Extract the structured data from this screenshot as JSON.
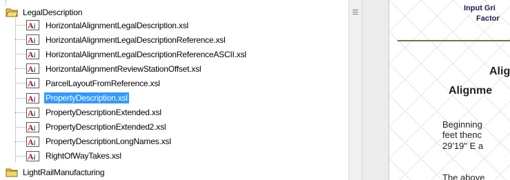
{
  "tree": {
    "parent_folder": "LegalDescription",
    "items": [
      "HorizontalAlignmentLegalDescription.xsl",
      "HorizontalAlignmentLegalDescriptionReference.xsl",
      "HorizontalAlignmentLegalDescriptionReferenceASCII.xsl",
      "HorizontalAlignmentReviewStationOffset.xsl",
      "ParcelLayoutFromReference.xsl",
      "PropertyDescription.xsl",
      "PropertyDescriptionExtended.xsl",
      "PropertyDescriptionExtended2.xsl",
      "PropertyDescriptionLongNames.xsl",
      "RightOfWayTakes.xsl"
    ],
    "selected_item": "PropertyDescription.xsl",
    "next_folder": "LightRailManufacturing"
  },
  "preview": {
    "header_line1": "Input Gri",
    "header_line2": "Factor",
    "title_line1": "Alig",
    "title_line2": "Alignme",
    "body_line1": "Beginning",
    "body_line2": "feet thenc",
    "body_line3": "29'19\" E a",
    "body_line4": "The above"
  },
  "colors": {
    "selection": "#3399ff",
    "rule": "#7a7038"
  }
}
